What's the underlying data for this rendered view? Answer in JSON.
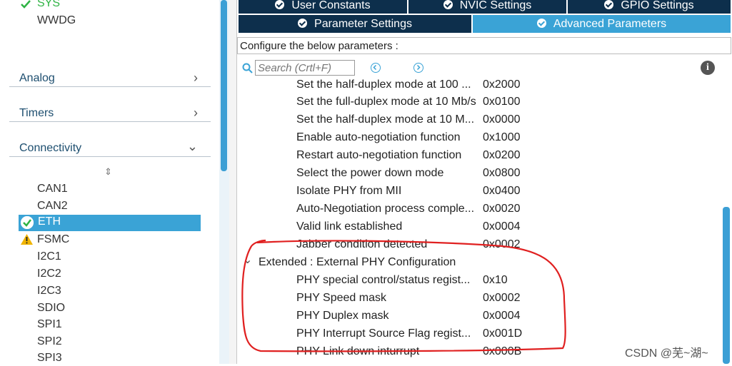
{
  "left": {
    "top_items": [
      "SYS",
      "WWDG"
    ],
    "categories": [
      {
        "label": "Analog",
        "chevron": "›"
      },
      {
        "label": "Timers",
        "chevron": "›"
      },
      {
        "label": "Connectivity",
        "chevron": "⌄"
      }
    ],
    "sort_icon": "⇕",
    "peripherals": [
      "CAN1",
      "CAN2",
      "ETH",
      "FSMC",
      "I2C1",
      "I2C2",
      "I2C3",
      "SDIO",
      "SPI1",
      "SPI2",
      "SPI3"
    ]
  },
  "tabs": {
    "row1": [
      "User Constants",
      "NVIC Settings",
      "GPIO Settings"
    ],
    "row2": [
      "Parameter Settings",
      "Advanced Parameters"
    ]
  },
  "config_label": "Configure the below parameters :",
  "search": {
    "placeholder": "Search (Crtl+F)"
  },
  "info_icon": "i",
  "params": [
    {
      "name": "Set the half-duplex mode at 100 ...",
      "value": "0x2000"
    },
    {
      "name": "Set the full-duplex mode at 10 Mb/s",
      "value": "0x0100"
    },
    {
      "name": "Set the half-duplex mode at 10 M...",
      "value": "0x0000"
    },
    {
      "name": "Enable auto-negotiation function",
      "value": "0x1000"
    },
    {
      "name": "Restart auto-negotiation function",
      "value": "0x0200"
    },
    {
      "name": "Select the power down mode",
      "value": "0x0800"
    },
    {
      "name": "Isolate PHY from MII",
      "value": "0x0400"
    },
    {
      "name": "Auto-Negotiation process comple...",
      "value": "0x0020"
    },
    {
      "name": "Valid link established",
      "value": "0x0004"
    },
    {
      "name": "Jabber condition detected",
      "value": "0x0002"
    }
  ],
  "section": {
    "label": "Extended : External PHY Configuration",
    "icon": "⌄"
  },
  "ext_params": [
    {
      "name": "PHY special control/status regist...",
      "value": "0x10"
    },
    {
      "name": "PHY Speed mask",
      "value": "0x0002"
    },
    {
      "name": "PHY Duplex mask",
      "value": "0x0004"
    },
    {
      "name": "PHY Interrupt Source Flag regist...",
      "value": "0x001D"
    },
    {
      "name": "PHY Link down inturrupt",
      "value": "0x000B"
    }
  ],
  "watermark": "CSDN @芜~湖~",
  "colors": {
    "tab_dark": "#0d2f4c",
    "tab_active": "#3aa3d6",
    "annotation": "#e02020"
  }
}
